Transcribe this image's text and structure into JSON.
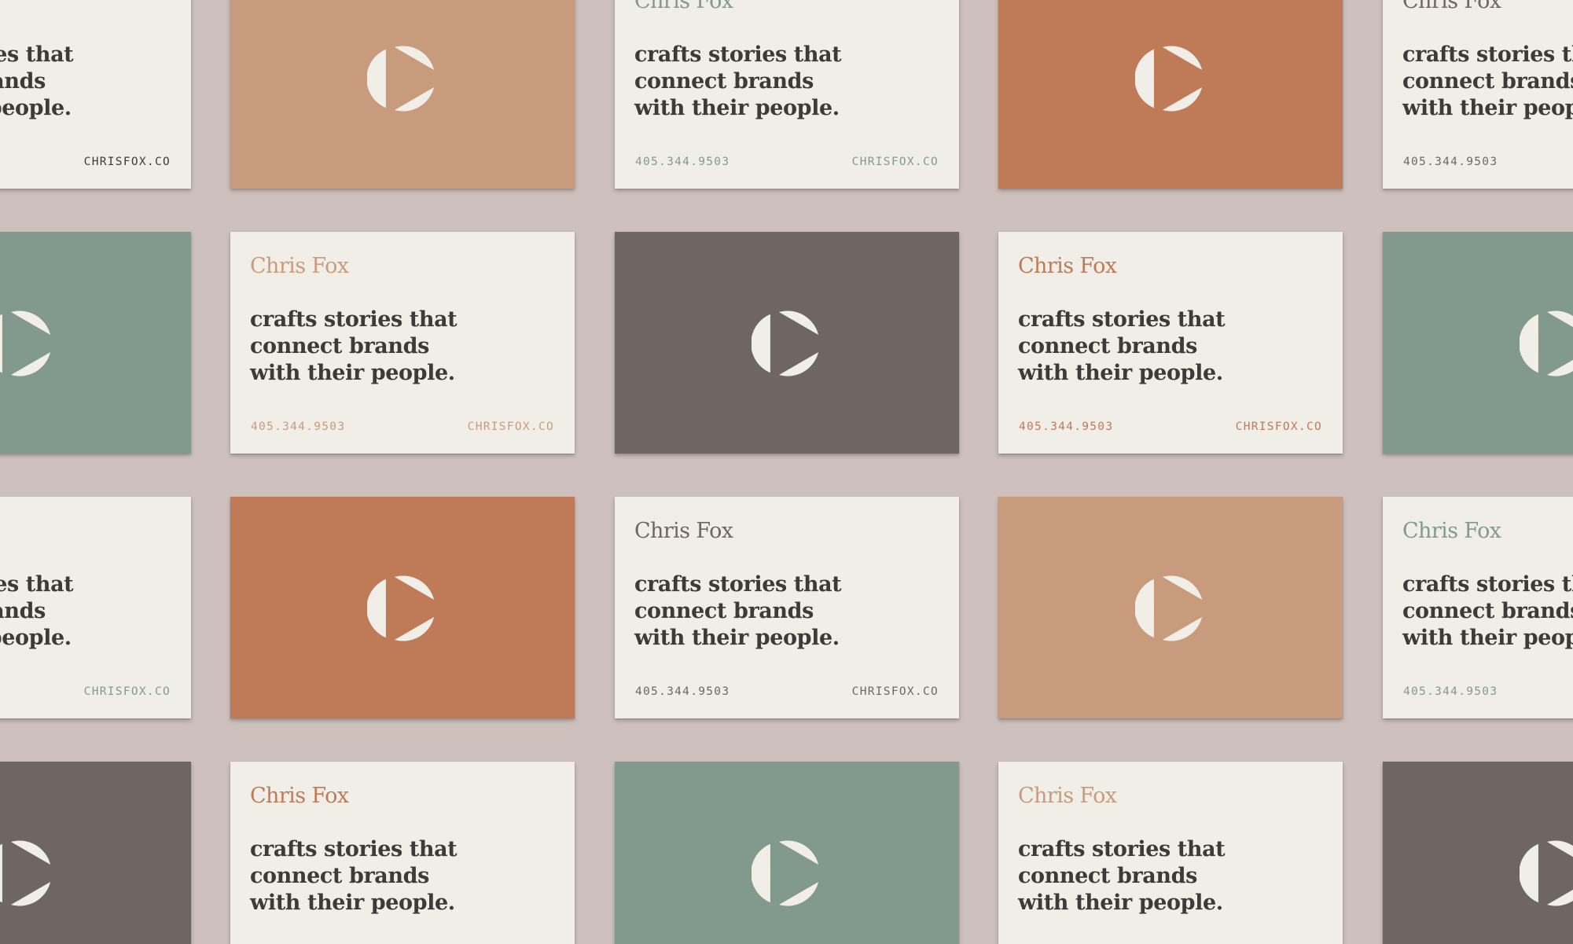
{
  "card_text": {
    "name": "Chris Fox",
    "tagline": [
      "crafts stories that",
      "connect brands",
      "with their people."
    ],
    "phone": "405.344.9503",
    "website": "CHRISFOX.CO"
  },
  "icons": {
    "logo": "play-logo-icon"
  },
  "colors": {
    "background": "#cdc0bd",
    "card_front": "#f1eee7",
    "logo_mark": "#f1eee7",
    "tagline": "#3d3a38",
    "tan": "#c89b7c",
    "terracotta": "#bf7a57",
    "sage": "#829a8d",
    "charcoal": "#6f6663"
  },
  "cards": [
    {
      "id": "r1c1",
      "kind": "front",
      "accent": "#3d3a38",
      "col": 0,
      "row": 0
    },
    {
      "id": "r1c2",
      "kind": "back",
      "bg": "#c89b7c",
      "col": 1,
      "row": 0
    },
    {
      "id": "r1c3",
      "kind": "front",
      "accent": "#829a8d",
      "col": 2,
      "row": 0
    },
    {
      "id": "r1c4",
      "kind": "back",
      "bg": "#bf7a57",
      "col": 3,
      "row": 0
    },
    {
      "id": "r1c5",
      "kind": "front",
      "accent": "#6f6663",
      "col": 4,
      "row": 0
    },
    {
      "id": "r2c1",
      "kind": "back",
      "bg": "#829a8d",
      "col": 0,
      "row": 1
    },
    {
      "id": "r2c2",
      "kind": "front",
      "accent": "#c89b7c",
      "col": 1,
      "row": 1
    },
    {
      "id": "r2c3",
      "kind": "back",
      "bg": "#6f6663",
      "col": 2,
      "row": 1
    },
    {
      "id": "r2c4",
      "kind": "front",
      "accent": "#bf7a57",
      "col": 3,
      "row": 1
    },
    {
      "id": "r2c5",
      "kind": "back",
      "bg": "#829a8d",
      "col": 4,
      "row": 1
    },
    {
      "id": "r3c1",
      "kind": "front",
      "accent": "#829a8d",
      "col": 0,
      "row": 2
    },
    {
      "id": "r3c2",
      "kind": "back",
      "bg": "#bf7a57",
      "col": 1,
      "row": 2
    },
    {
      "id": "r3c3",
      "kind": "front",
      "accent": "#6f6663",
      "col": 2,
      "row": 2
    },
    {
      "id": "r3c4",
      "kind": "back",
      "bg": "#c89b7c",
      "col": 3,
      "row": 2
    },
    {
      "id": "r3c5",
      "kind": "front",
      "accent": "#829a8d",
      "col": 4,
      "row": 2
    },
    {
      "id": "r4c1",
      "kind": "back",
      "bg": "#6f6663",
      "col": 0,
      "row": 3
    },
    {
      "id": "r4c2",
      "kind": "front",
      "accent": "#bf7a57",
      "col": 1,
      "row": 3
    },
    {
      "id": "r4c3",
      "kind": "back",
      "bg": "#829a8d",
      "col": 2,
      "row": 3
    },
    {
      "id": "r4c4",
      "kind": "front",
      "accent": "#c89b7c",
      "col": 3,
      "row": 3
    },
    {
      "id": "r4c5",
      "kind": "back",
      "bg": "#6f6663",
      "col": 4,
      "row": 3
    }
  ]
}
